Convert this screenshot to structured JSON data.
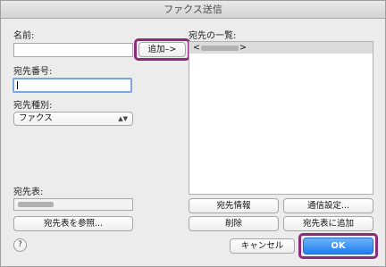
{
  "window": {
    "title": "ファクス送信"
  },
  "labels": {
    "name": "名前:",
    "number": "宛先番号:",
    "type": "宛先種別:",
    "list": "宛先の一覧:",
    "addressbook": "宛先表:"
  },
  "fields": {
    "name_value": "",
    "number_value": "",
    "type_selected": "ファクス"
  },
  "buttons": {
    "add": "追加–>",
    "browse": "宛先表を参照...",
    "info": "宛先情報",
    "comm": "通信設定...",
    "delete": "削除",
    "add_to_book": "宛先表に追加",
    "cancel": "キャンセル",
    "ok": "OK",
    "help": "?"
  },
  "list": {
    "rows": [
      {
        "prefix": "<",
        "suffix": ">"
      }
    ]
  },
  "colors": {
    "highlight": "#8a2c78",
    "ok_button": "#1f7ef0"
  }
}
